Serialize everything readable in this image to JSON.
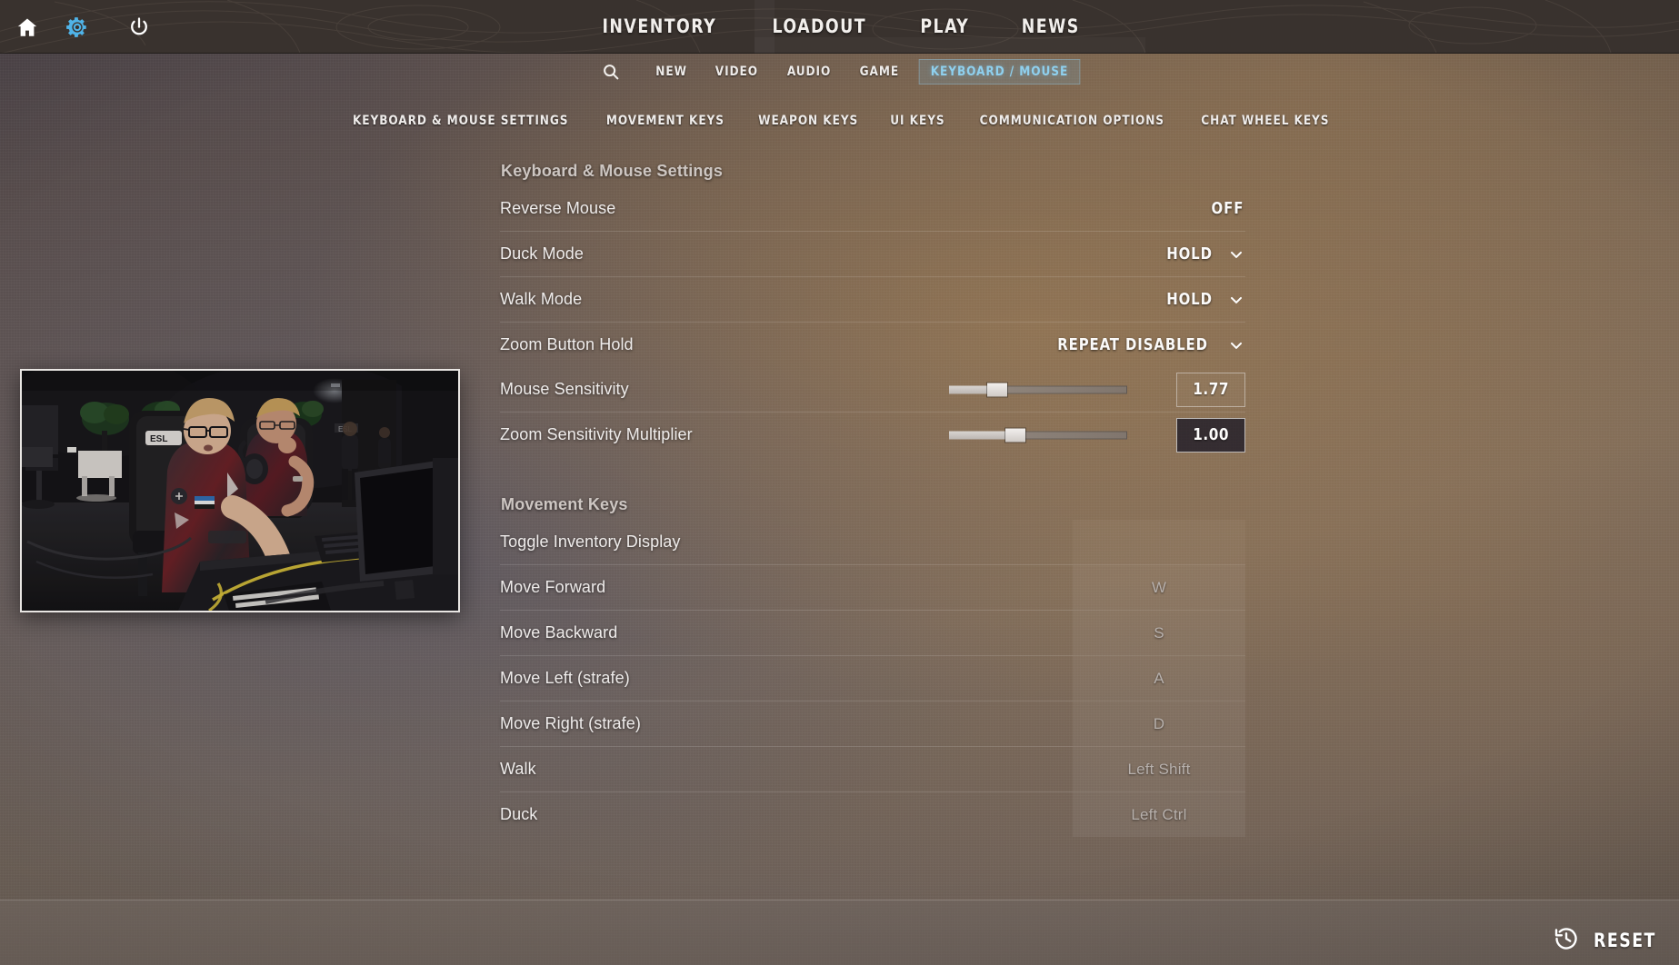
{
  "topbar": {
    "icons": [
      {
        "name": "home-icon",
        "label": "Home"
      },
      {
        "name": "gear-icon",
        "label": "Settings"
      },
      {
        "name": "power-icon",
        "label": "Quit"
      }
    ],
    "nav": [
      {
        "label": "INVENTORY"
      },
      {
        "label": "LOADOUT"
      },
      {
        "label": "PLAY"
      },
      {
        "label": "NEWS"
      }
    ]
  },
  "settings_tabs": {
    "search_icon": "search-icon",
    "items": [
      {
        "label": "NEW",
        "active": false
      },
      {
        "label": "VIDEO",
        "active": false
      },
      {
        "label": "AUDIO",
        "active": false
      },
      {
        "label": "GAME",
        "active": false
      },
      {
        "label": "KEYBOARD / MOUSE",
        "active": true
      }
    ],
    "active_color": "#8fd0ee"
  },
  "sub_tabs": [
    {
      "label": "KEYBOARD & MOUSE SETTINGS"
    },
    {
      "label": "MOVEMENT KEYS"
    },
    {
      "label": "WEAPON KEYS"
    },
    {
      "label": "UI KEYS"
    },
    {
      "label": "COMMUNICATION OPTIONS"
    },
    {
      "label": "CHAT WHEEL KEYS"
    }
  ],
  "sections": [
    {
      "title": "Keyboard & Mouse Settings",
      "rows": [
        {
          "label": "Reverse Mouse",
          "type": "value",
          "value": "OFF",
          "chevron": false
        },
        {
          "label": "Duck Mode",
          "type": "value",
          "value": "HOLD",
          "chevron": true
        },
        {
          "label": "Walk Mode",
          "type": "value",
          "value": "HOLD",
          "chevron": true
        },
        {
          "label": "Zoom Button Hold",
          "type": "value",
          "value": "REPEAT DISABLED",
          "chevron": true
        },
        {
          "label": "Mouse Sensitivity",
          "type": "slider",
          "value": "1.77",
          "percent": 27,
          "focused": false
        },
        {
          "label": "Zoom Sensitivity Multiplier",
          "type": "slider",
          "value": "1.00",
          "percent": 37,
          "focused": true
        }
      ]
    },
    {
      "title": "Movement Keys",
      "rows": [
        {
          "label": "Toggle Inventory Display",
          "type": "key",
          "value": ""
        },
        {
          "label": "Move Forward",
          "type": "key",
          "value": "W"
        },
        {
          "label": "Move Backward",
          "type": "key",
          "value": "S"
        },
        {
          "label": "Move Left (strafe)",
          "type": "key",
          "value": "A"
        },
        {
          "label": "Move Right (strafe)",
          "type": "key",
          "value": "D"
        },
        {
          "label": "Walk",
          "type": "key",
          "value": "Left Shift"
        },
        {
          "label": "Duck",
          "type": "key",
          "value": "Left Ctrl"
        }
      ]
    }
  ],
  "thumbnail": {
    "name": "video-preview-thumbnail",
    "description": "Two esports players at LAN tournament desk"
  },
  "footer": {
    "reset_label": "RESET",
    "reset_icon": "history-restore-icon"
  }
}
